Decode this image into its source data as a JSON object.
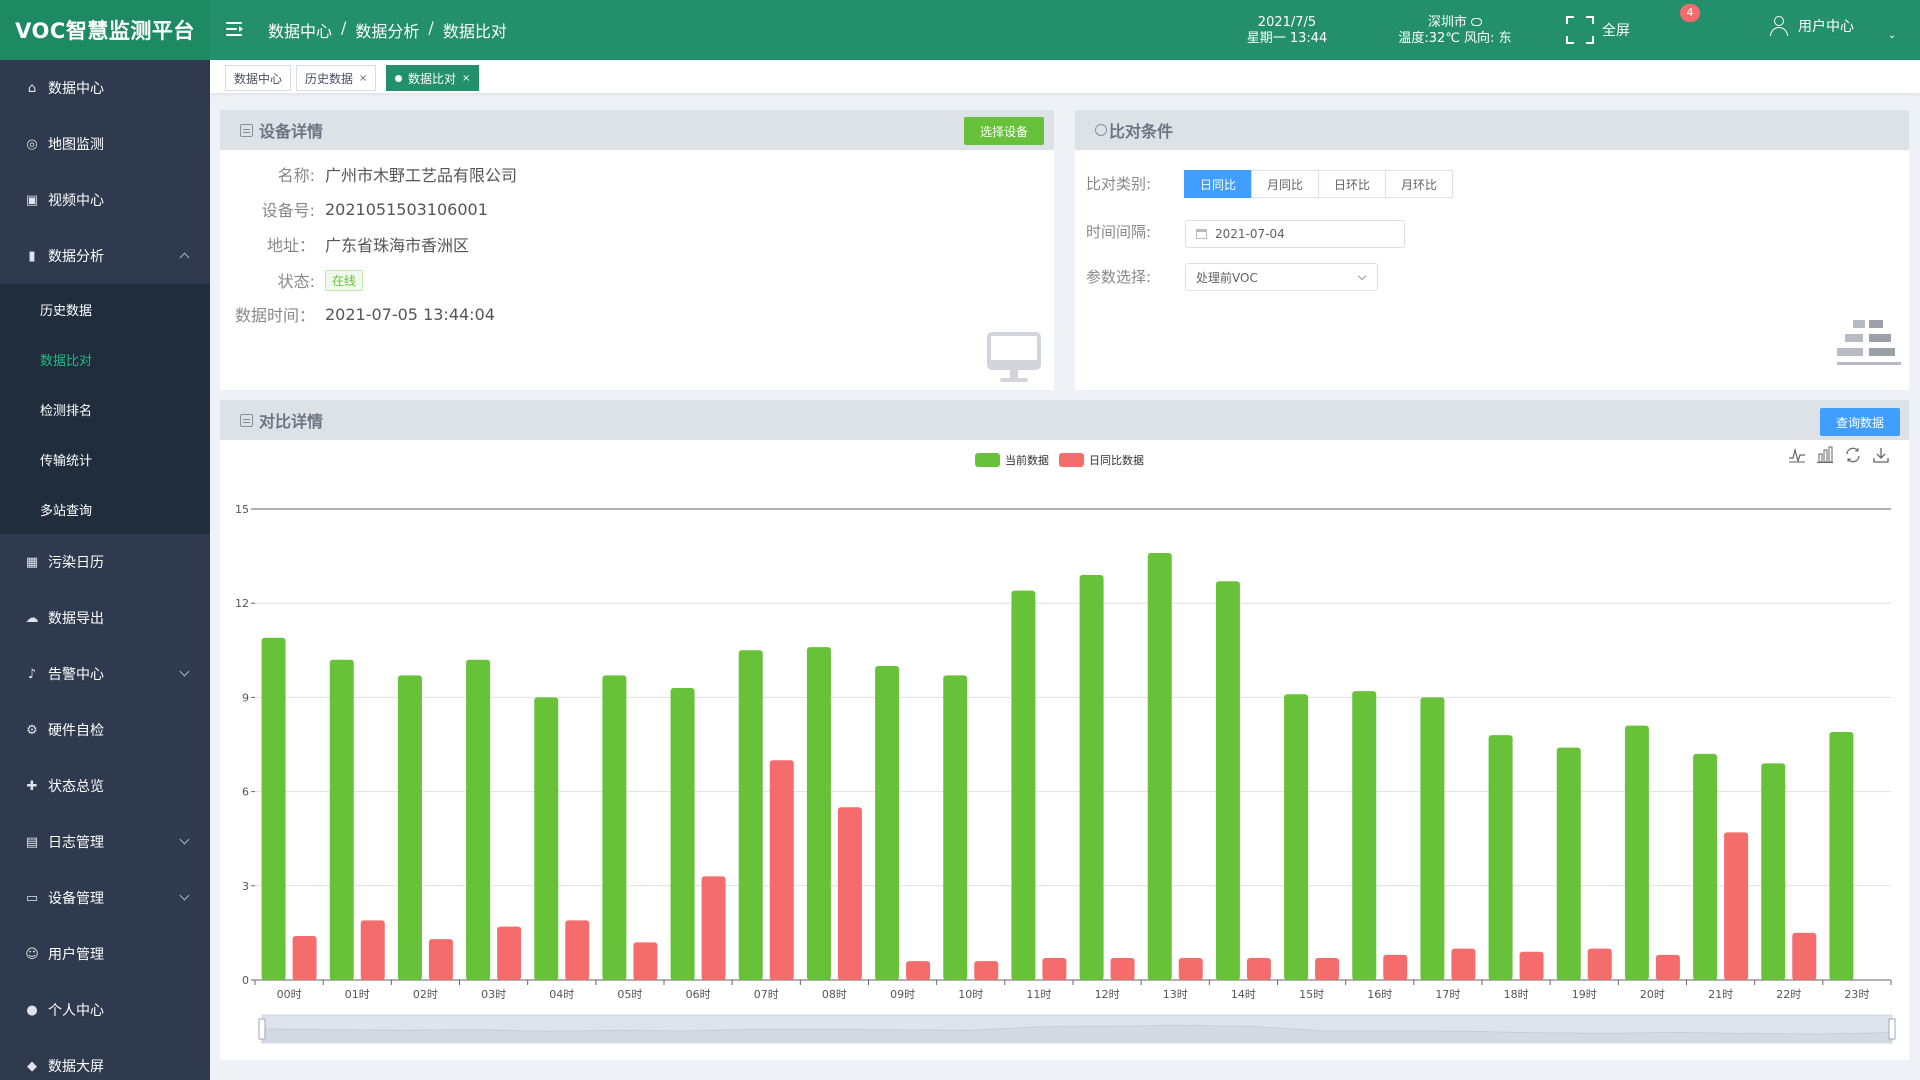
{
  "header": {
    "brand": "VOC智慧监测平台",
    "breadcrumb": [
      "数据中心",
      "数据分析",
      "数据比对"
    ],
    "breadcrumb_sep": "/",
    "date": "2021/7/5",
    "weekday_time": "星期一 13:44",
    "city": "深圳市",
    "weather": "温度:32℃ 风向: 东",
    "fullscreen_label": "全屏",
    "notification_count": "4",
    "user_label": "用户中心"
  },
  "sidebar": {
    "items": [
      {
        "label": "数据中心",
        "icon": "home-icon",
        "glyph": "⌂"
      },
      {
        "label": "地图监测",
        "icon": "map-pin-icon",
        "glyph": "◎"
      },
      {
        "label": "视频中心",
        "icon": "video-icon",
        "glyph": "▣"
      },
      {
        "label": "数据分析",
        "icon": "bar-chart-icon",
        "glyph": "▮",
        "expanded": true
      }
    ],
    "sub_items": [
      {
        "label": "历史数据"
      },
      {
        "label": "数据比对",
        "active": true
      },
      {
        "label": "检测排名"
      },
      {
        "label": "传输统计"
      },
      {
        "label": "多站查询"
      }
    ],
    "items_after": [
      {
        "label": "污染日历",
        "icon": "calendar-icon",
        "glyph": "▦"
      },
      {
        "label": "数据导出",
        "icon": "cloud-upload-icon",
        "glyph": "☁"
      },
      {
        "label": "告警中心",
        "icon": "bell-icon",
        "glyph": "♪",
        "has_children": true
      },
      {
        "label": "硬件自检",
        "icon": "chip-icon",
        "glyph": "⚙"
      },
      {
        "label": "状态总览",
        "icon": "status-icon",
        "glyph": "✚"
      },
      {
        "label": "日志管理",
        "icon": "log-icon",
        "glyph": "▤",
        "has_children": true
      },
      {
        "label": "设备管理",
        "icon": "monitor-icon",
        "glyph": "▭",
        "has_children": true
      },
      {
        "label": "用户管理",
        "icon": "user-icon",
        "glyph": "☺"
      },
      {
        "label": "个人中心",
        "icon": "person-icon",
        "glyph": "●"
      },
      {
        "label": "数据大屏",
        "icon": "screen-icon",
        "glyph": "◆"
      }
    ]
  },
  "tags": [
    {
      "label": "数据中心",
      "closable": false
    },
    {
      "label": "历史数据",
      "closable": true
    },
    {
      "label": "数据比对",
      "closable": true,
      "active": true
    }
  ],
  "device_card": {
    "title": "设备详情",
    "select_button": "选择设备",
    "rows": [
      {
        "label": "名称:",
        "value": "广州市木野工艺品有限公司"
      },
      {
        "label": "设备号:",
        "value": "2021051503106001"
      },
      {
        "label": "地址：",
        "value": "广东省珠海市香洲区"
      },
      {
        "label": "状态:",
        "value": "在线",
        "is_tag": true
      },
      {
        "label": "数据时间：",
        "value": "2021-07-05 13:44:04"
      }
    ]
  },
  "condition_card": {
    "title": "比对条件",
    "type_label": "比对类别:",
    "types": [
      "日同比",
      "月同比",
      "日环比",
      "月环比"
    ],
    "active_type": 0,
    "interval_label": "时间间隔:",
    "interval_value": "2021-07-04",
    "param_label": "参数选择:",
    "param_value": "处理前VOC"
  },
  "compare_card": {
    "title": "对比详情",
    "query_button": "查询数据"
  },
  "chart_data": {
    "type": "bar",
    "categories": [
      "00时",
      "01时",
      "02时",
      "03时",
      "04时",
      "05时",
      "06时",
      "07时",
      "08时",
      "09时",
      "10时",
      "11时",
      "12时",
      "13时",
      "14时",
      "15时",
      "16时",
      "17时",
      "18时",
      "19时",
      "20时",
      "21时",
      "22时",
      "23时"
    ],
    "series": [
      {
        "name": "当前数据",
        "color": "#67c23a",
        "values": [
          10.9,
          10.2,
          9.7,
          10.2,
          9.0,
          9.7,
          9.3,
          10.5,
          10.6,
          10.0,
          9.7,
          12.4,
          12.9,
          13.6,
          12.7,
          9.1,
          9.2,
          9.0,
          7.8,
          7.4,
          8.1,
          7.2,
          6.9,
          7.9
        ]
      },
      {
        "name": "日同比数据",
        "color": "#f56c6c",
        "values": [
          1.4,
          1.9,
          1.3,
          1.7,
          1.9,
          1.2,
          3.3,
          7.0,
          5.5,
          0.6,
          0.6,
          0.7,
          0.7,
          0.7,
          0.7,
          0.7,
          0.8,
          1.0,
          0.9,
          1.0,
          0.8,
          4.7,
          1.5,
          0
        ]
      }
    ],
    "y_ticks": [
      0,
      3,
      6,
      9,
      12,
      15
    ],
    "ylim": [
      0,
      15
    ],
    "grid": true,
    "legend": "top-center"
  }
}
